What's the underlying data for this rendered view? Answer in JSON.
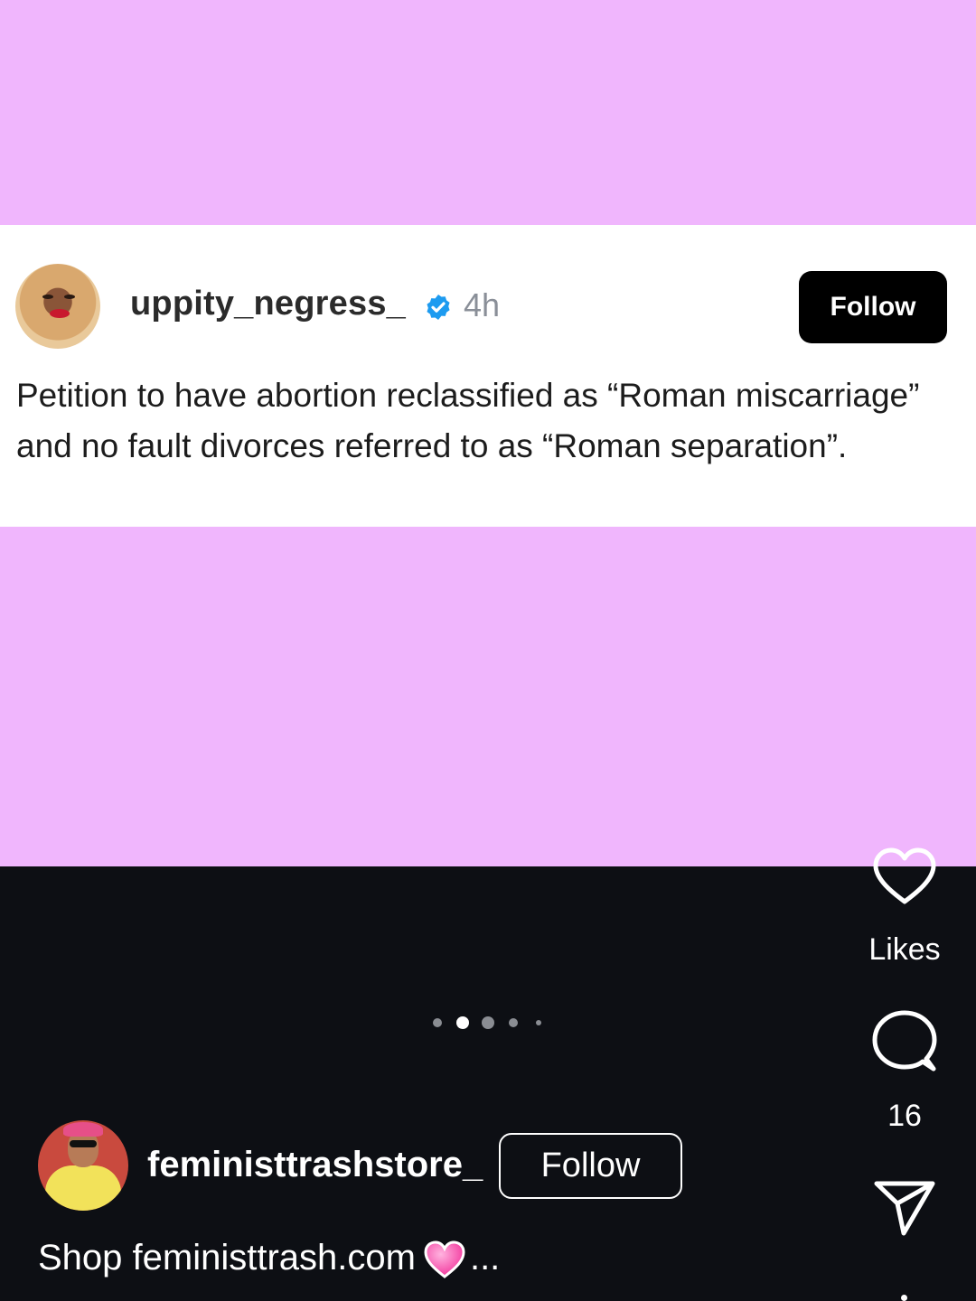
{
  "tweet": {
    "username": "uppity_negress_",
    "time": "4h",
    "follow_label": "Follow",
    "text": "Petition to have abortion reclassified as “Roman miscarriage” and no fault divorces referred to as “Roman separation”."
  },
  "actions": {
    "likes_label": "Likes",
    "comments_count": "16"
  },
  "post": {
    "account_name": "feministtrashstore_",
    "follow_label": "Follow",
    "caption_text": "Shop feministtrash.com",
    "caption_more": "..."
  },
  "pager": {
    "total": 5,
    "active_index": 1
  },
  "colors": {
    "background_pink": "#f0b6fd",
    "dark_bg": "#0d0f14",
    "verified_blue": "#1d9bf0"
  },
  "icons": [
    "verified-icon",
    "heart-icon",
    "comment-icon",
    "share-icon",
    "pink-heart-emoji"
  ]
}
